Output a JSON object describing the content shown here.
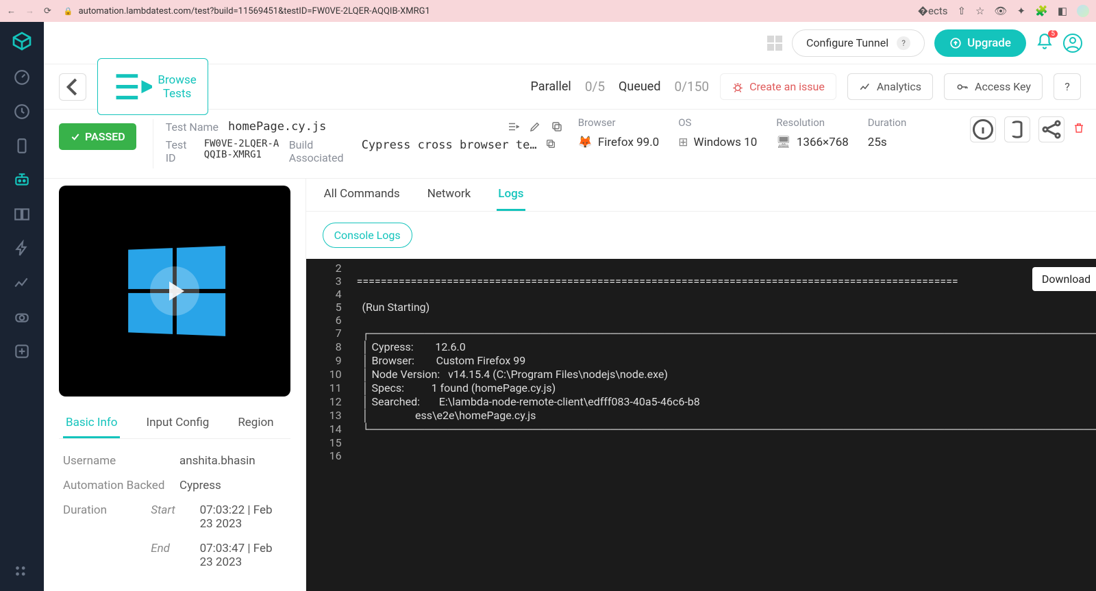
{
  "browser": {
    "url": "automation.lambdatest.com/test?build=11569451&testID=FW0VE-2LQER-AQQIB-XMRG1"
  },
  "topbar": {
    "configure_tunnel": "Configure Tunnel",
    "upgrade": "Upgrade",
    "notif_count": "5"
  },
  "actionbar": {
    "browse_tests": "Browse Tests",
    "parallel_label": "Parallel",
    "parallel_value": "0/5",
    "queued_label": "Queued",
    "queued_value": "0/150",
    "create_issue": "Create an issue",
    "analytics": "Analytics",
    "access_key": "Access Key",
    "help": "?"
  },
  "status": {
    "label": "PASSED"
  },
  "meta": {
    "test_name_label": "Test Name",
    "test_name": "homePage.cy.js",
    "test_id_label": "Test ID",
    "test_id": "FW0VE-2LQER-AQQIB-XMRG1",
    "build_label": "Build Associated",
    "build_name": "Cypress cross browser te…"
  },
  "env": {
    "browser_label": "Browser",
    "browser_val": "Firefox 99.0",
    "os_label": "OS",
    "os_val": "Windows 10",
    "res_label": "Resolution",
    "res_val": "1366×768",
    "dur_label": "Duration",
    "dur_val": "25s"
  },
  "info_tabs": {
    "basic": "Basic Info",
    "input": "Input Config",
    "region": "Region"
  },
  "info": {
    "username_label": "Username",
    "username": "anshita.bhasin",
    "backed_label": "Automation Backed",
    "backed": "Cypress",
    "duration_label": "Duration",
    "start_label": "Start",
    "start": "07:03:22 | Feb 23 2023",
    "end_label": "End",
    "end": "07:03:47 | Feb 23 2023"
  },
  "log_tabs": {
    "all": "All Commands",
    "network": "Network",
    "logs": "Logs"
  },
  "log_sub": {
    "console": "Console Logs"
  },
  "download": "Download",
  "console_lines": [
    {
      "n": "2",
      "t": ""
    },
    {
      "n": "3",
      "t": "===================================================================================================="
    },
    {
      "n": "4",
      "t": ""
    },
    {
      "n": "5",
      "t": "  (Run Starting)"
    },
    {
      "n": "6",
      "t": ""
    },
    {
      "n": "7",
      "t": "  ┌────────────────────────────────────────────────────────────────────────────────────────────────"
    },
    {
      "n": "8",
      "t": "  │ Cypress:        12.6.0"
    },
    {
      "n": "9",
      "t": "  │ Browser:        Custom Firefox 99"
    },
    {
      "n": "10",
      "t": "  │ Node Version:   v14.15.4 (C:\\Program Files\\nodejs\\node.exe)"
    },
    {
      "n": "11",
      "t": "  │ Specs:          1 found (homePage.cy.js)"
    },
    {
      "n": "12",
      "t": "  │ Searched:       E:\\lambda-node-remote-client\\edfff083-40a5-46c6-b8"
    },
    {
      "n": "13",
      "t": "  │                 ess\\e2e\\homePage.cy.js"
    },
    {
      "n": "14",
      "t": "  └────────────────────────────────────────────────────────────────────────────────────────────────"
    },
    {
      "n": "15",
      "t": ""
    },
    {
      "n": "16",
      "t": ""
    }
  ]
}
